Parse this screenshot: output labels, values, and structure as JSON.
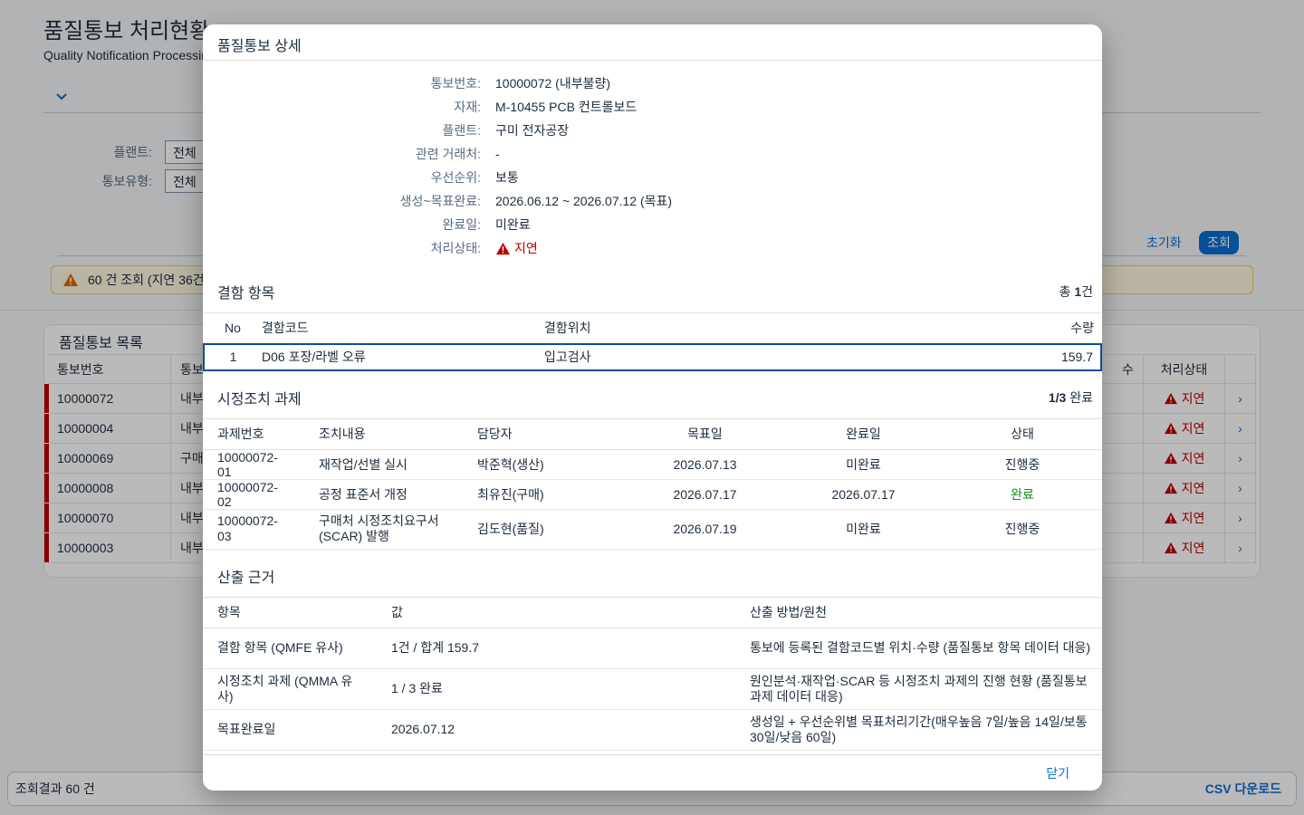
{
  "page": {
    "title": "품질통보 처리현황",
    "subtitle": "Quality Notification Processing"
  },
  "filters": [
    {
      "label": "플랜트:",
      "value": "전체"
    },
    {
      "label": "통보유형:",
      "value": "전체"
    }
  ],
  "actions": {
    "reset": "초기화",
    "search": "조회"
  },
  "banner": {
    "text": "60 건 조회 (지연 36건"
  },
  "list": {
    "title": "품질통보 목록",
    "columns": {
      "no": "통보번호",
      "type": "통보",
      "qty": "수",
      "status": "처리상태"
    },
    "rows": [
      {
        "no": "10000072",
        "type": "내부",
        "status": "지연"
      },
      {
        "no": "10000004",
        "type": "내부",
        "status": "지연"
      },
      {
        "no": "10000069",
        "type": "구매",
        "status": "지연"
      },
      {
        "no": "10000008",
        "type": "내부",
        "status": "지연"
      },
      {
        "no": "10000070",
        "type": "내부",
        "status": "지연"
      },
      {
        "no": "10000003",
        "type": "내부",
        "status": "지연"
      }
    ]
  },
  "footer": {
    "count": "조회결과 60 건",
    "csv": "CSV 다운로드"
  },
  "dialog": {
    "title": "품질통보 상세",
    "info": [
      {
        "label": "통보번호:",
        "value": "10000072 (내부불량)"
      },
      {
        "label": "자재:",
        "value": "M-10455 PCB 컨트롤보드"
      },
      {
        "label": "플랜트:",
        "value": "구미 전자공장"
      },
      {
        "label": "관련 거래처:",
        "value": "-"
      },
      {
        "label": "우선순위:",
        "value": "보통"
      },
      {
        "label": "생성~목표완료:",
        "value": "2026.06.12 ~ 2026.07.12 (목표)"
      },
      {
        "label": "완료일:",
        "value": "미완료"
      },
      {
        "label": "처리상태:",
        "value": "지연"
      }
    ],
    "defects": {
      "title": "결함 항목",
      "count_prefix": "총",
      "count_num": "1",
      "count_suffix": "건",
      "headers": [
        "No",
        "결함코드",
        "결함위치",
        "수량"
      ],
      "rows": [
        {
          "no": "1",
          "code": "D06 포장/라벨 오류",
          "location": "입고검사",
          "qty": "159.7"
        }
      ]
    },
    "tasks": {
      "title": "시정조치 과제",
      "count_num": "1/3",
      "count_suffix": "완료",
      "headers": [
        "과제번호",
        "조치내용",
        "담당자",
        "목표일",
        "완료일",
        "상태"
      ],
      "rows": [
        {
          "id": "10000072-01",
          "content": "재작업/선별 실시",
          "owner": "박준혁(생산)",
          "target": "2026.07.13",
          "done": "미완료",
          "status": "진행중"
        },
        {
          "id": "10000072-02",
          "content": "공정 표준서 개정",
          "owner": "최유진(구매)",
          "target": "2026.07.17",
          "done": "2026.07.17",
          "status": "완료"
        },
        {
          "id": "10000072-03",
          "content": "구매처 시정조치요구서 (SCAR) 발행",
          "owner": "김도현(품질)",
          "target": "2026.07.19",
          "done": "미완료",
          "status": "진행중"
        }
      ]
    },
    "basis": {
      "title": "산출 근거",
      "headers": [
        "항목",
        "값",
        "산출 방법/원천"
      ],
      "rows": [
        {
          "item": "결함 항목 (QMFE 유사)",
          "value": "1건 / 합계 159.7",
          "method": "통보에 등록된 결함코드별 위치·수량 (품질통보 항목 데이터 대응)"
        },
        {
          "item": "시정조치 과제 (QMMA 유사)",
          "value": "1 / 3 완료",
          "method": "원인분석·재작업·SCAR 등 시정조치 과제의 진행 현황 (품질통보 과제 데이터 대응)"
        },
        {
          "item": "목표완료일",
          "value": "2026.07.12",
          "method": "생성일 + 우선순위별 목표처리기간(매우높음 7일/높음 14일/보통 30일/낮음 60일)"
        }
      ]
    },
    "close": "닫기"
  },
  "colors": {
    "accent": "#0a6ed1",
    "error": "#bb0000",
    "success": "#188918"
  }
}
